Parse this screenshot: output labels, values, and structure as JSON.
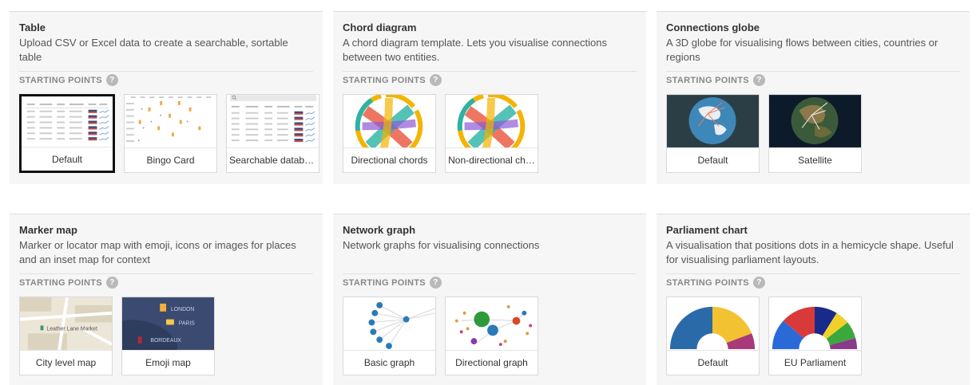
{
  "starting_points_label": "STARTING POINTS",
  "help_icon": "?",
  "panels": [
    {
      "title": "Table",
      "description": "Upload CSV or Excel data to create a searchable, sortable table",
      "cards": [
        {
          "label": "Default",
          "icon": "table-thumbnail",
          "selected": true
        },
        {
          "label": "Bingo Card",
          "icon": "bingo-thumbnail"
        },
        {
          "label": "Searchable database",
          "icon": "database-thumbnail"
        }
      ]
    },
    {
      "title": "Chord diagram",
      "description": "A chord diagram template. Lets you visualise connections between two entities.",
      "cards": [
        {
          "label": "Directional chords",
          "icon": "chord-thumbnail"
        },
        {
          "label": "Non-directional ch…",
          "icon": "chord-thumbnail"
        }
      ]
    },
    {
      "title": "Connections globe",
      "description": "A 3D globe for visualising flows between cities, countries or regions",
      "cards": [
        {
          "label": "Default",
          "icon": "globe-thumbnail"
        },
        {
          "label": "Satellite",
          "icon": "satellite-globe-thumbnail"
        }
      ]
    },
    {
      "title": "Marker map",
      "description": "Marker or locator map with emoji, icons or images for places and an inset map for context",
      "cards": [
        {
          "label": "City level map",
          "icon": "city-map-thumbnail",
          "map_text": "Leather Lane Market"
        },
        {
          "label": "Emoji map",
          "icon": "emoji-map-thumbnail",
          "map_text": [
            "LONDON",
            "PARIS",
            "BORDEAUX"
          ]
        }
      ]
    },
    {
      "title": "Network graph",
      "description": "Network graphs for visualising connections",
      "cards": [
        {
          "label": "Basic graph",
          "icon": "network-thumbnail"
        },
        {
          "label": "Directional graph",
          "icon": "directional-network-thumbnail"
        }
      ]
    },
    {
      "title": "Parliament chart",
      "description": "A visualisation that positions dots in a hemicycle shape. Useful for visualising parliament layouts.",
      "cards": [
        {
          "label": "Default",
          "icon": "hemicycle-thumbnail"
        },
        {
          "label": "EU Parliament",
          "icon": "eu-hemicycle-thumbnail"
        }
      ]
    }
  ],
  "colors": {
    "panel_bg": "#f6f6f6",
    "selected_border": "#111111",
    "help_icon_bg": "#b9b9b9"
  }
}
